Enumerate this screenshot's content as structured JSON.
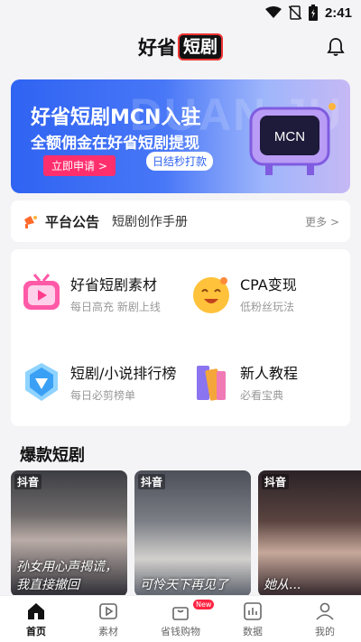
{
  "status_bar": {
    "time": "2:41"
  },
  "header": {
    "title_prefix": "好省",
    "title_badge": "短剧"
  },
  "banner": {
    "title": "好省短剧MCN入驻",
    "subtitle": "全额佣金在好省短剧提现",
    "apply_label": "立即申请 >",
    "settle_label": "日结秒打款",
    "tv_text": "MCN",
    "bg_text": "DUAN JU"
  },
  "notice": {
    "label": "平台公告",
    "text": "短剧创作手册",
    "more": "更多 >"
  },
  "features": [
    {
      "title": "好省短剧素材",
      "subtitle": "每日高充 新剧上线"
    },
    {
      "title": "CPA变现",
      "subtitle": "低粉丝玩法"
    },
    {
      "title": "短剧/小说排行榜",
      "subtitle": "每日必剪榜单"
    },
    {
      "title": "新人教程",
      "subtitle": "必看宝典"
    }
  ],
  "section": {
    "title": "爆款短剧"
  },
  "posters": [
    {
      "tag": "抖音",
      "caption": "孙女用心声揭谎，我直接撤回"
    },
    {
      "tag": "抖音",
      "caption": "可怜天下再见了"
    },
    {
      "tag": "抖音",
      "caption": "她从..."
    }
  ],
  "tabbar": {
    "items": [
      {
        "label": "首页",
        "icon": "home-icon"
      },
      {
        "label": "素材",
        "icon": "play-icon"
      },
      {
        "label": "省钱购物",
        "icon": "bag-icon",
        "badge": "New"
      },
      {
        "label": "数据",
        "icon": "chart-icon"
      },
      {
        "label": "我的",
        "icon": "person-icon"
      }
    ]
  }
}
